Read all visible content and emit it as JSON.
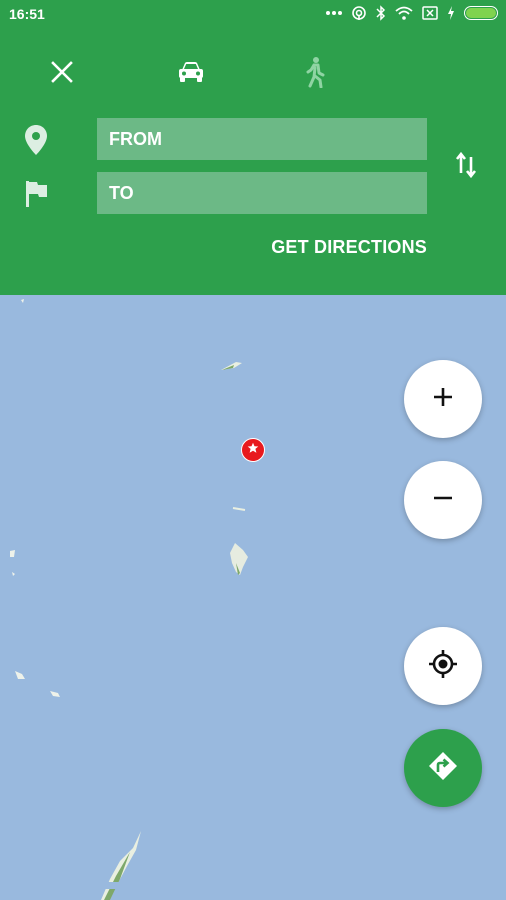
{
  "status_bar": {
    "time": "16:51"
  },
  "header": {
    "from_placeholder": "FROM",
    "to_placeholder": "TO",
    "get_directions_label": "GET DIRECTIONS",
    "modes": [
      "close",
      "drive",
      "walk"
    ],
    "active_mode": "drive"
  },
  "map": {
    "zoom_in_label": "+",
    "zoom_out_label": "−"
  },
  "colors": {
    "header": "#2da04c",
    "field": "#6cb986",
    "map": "#99b9de",
    "marker": "#e8191e"
  }
}
